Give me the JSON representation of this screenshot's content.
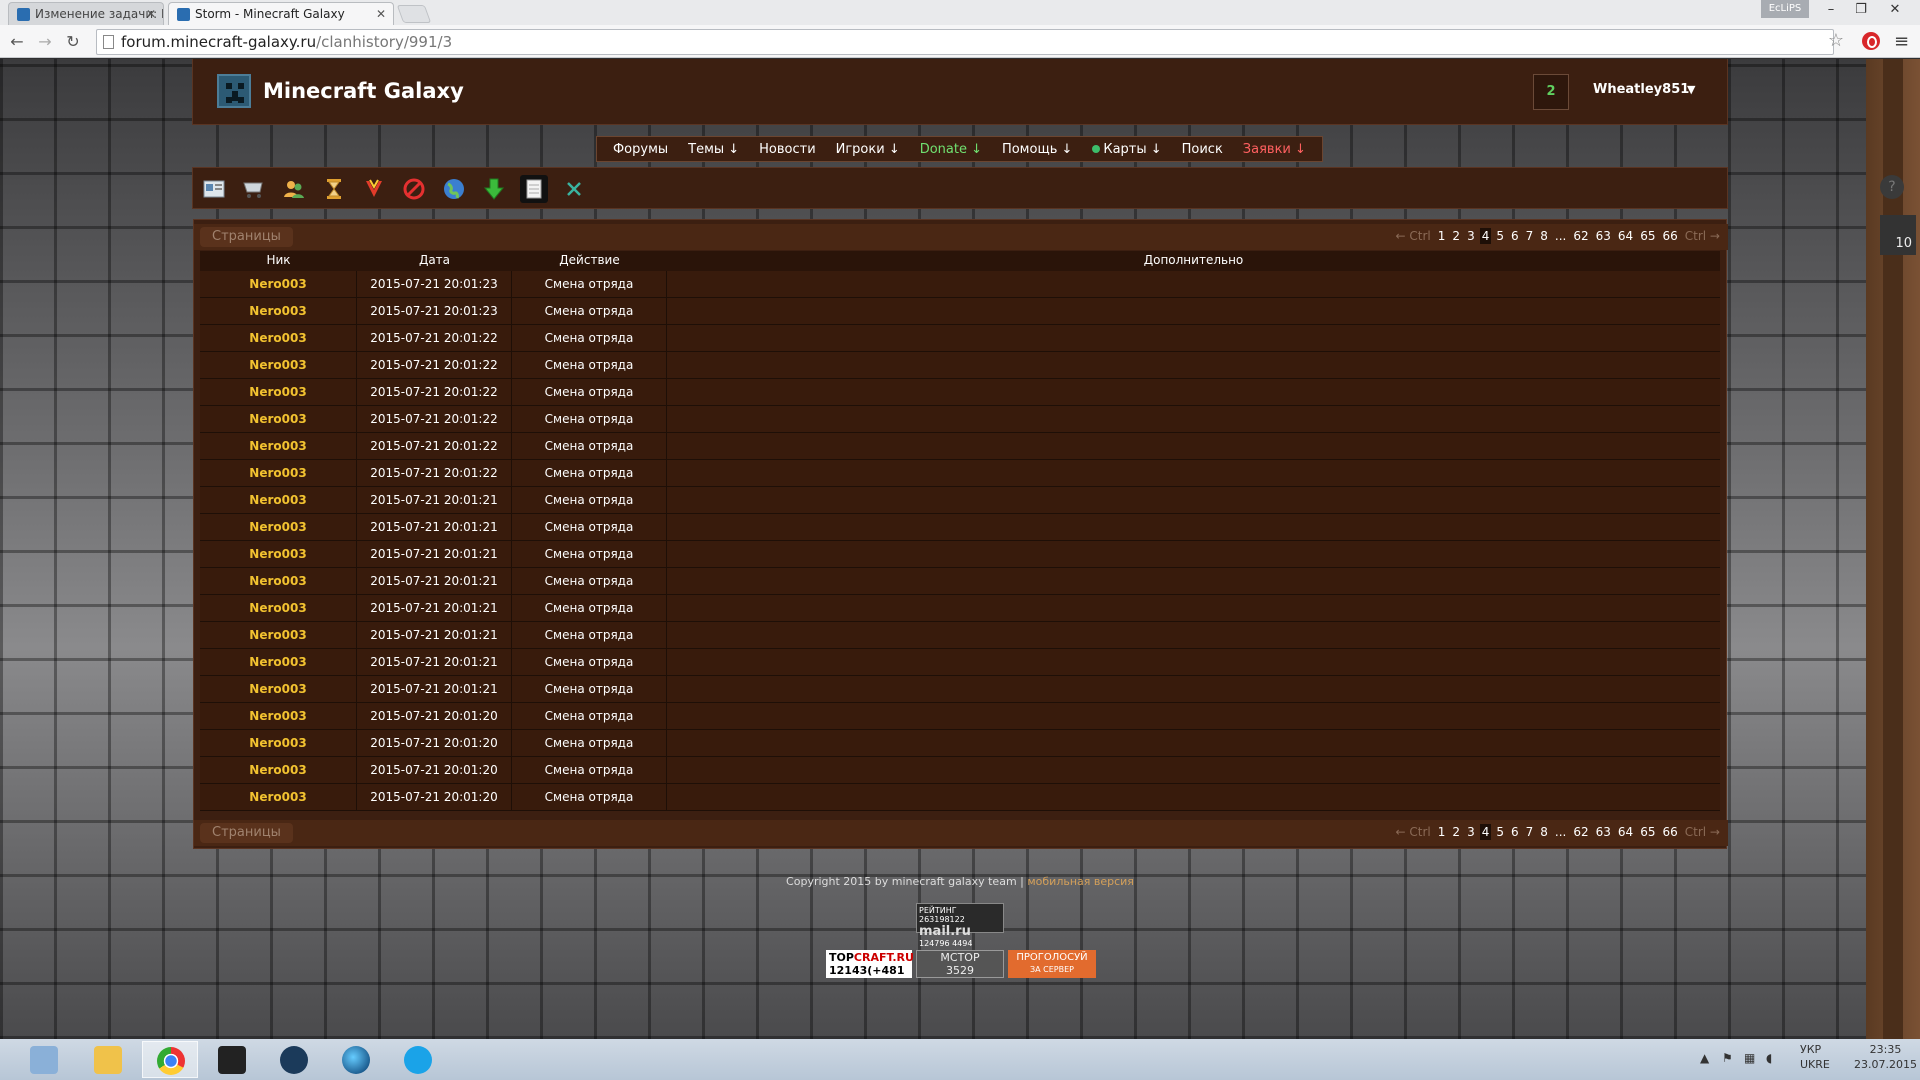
{
  "browser": {
    "tabs": [
      {
        "title": "Изменение задачи: Баг с"
      },
      {
        "title": "Storm - Minecraft Galaxy"
      }
    ],
    "profile": "EcLiPS",
    "url_host": "forum.minecraft-galaxy.ru",
    "url_path": "/clanhistory/991/3"
  },
  "site": {
    "title": "Minecraft Galaxy",
    "notifications": "2",
    "username": "Wheatley851",
    "nav": [
      "Форумы",
      "Темы ↓",
      "Новости",
      "Игроки ↓",
      "Donate ↓",
      "Помощь ↓",
      "Карты ↓",
      "Поиск",
      "Заявки ↓"
    ]
  },
  "pager": {
    "label": "Страницы",
    "prev": "← Ctrl",
    "next": "Ctrl →",
    "pages": [
      "1",
      "2",
      "3",
      "4",
      "5",
      "6",
      "7",
      "8",
      "...",
      "62",
      "63",
      "64",
      "65",
      "66"
    ],
    "current": "3"
  },
  "table": {
    "headers": {
      "nick": "Ник",
      "date": "Дата",
      "action": "Действие",
      "extra": "Дополнительно"
    },
    "rows": [
      {
        "nick": "Nero003",
        "date": "2015-07-21 20:01:23",
        "action": "Смена отряда",
        "extra": ""
      },
      {
        "nick": "Nero003",
        "date": "2015-07-21 20:01:23",
        "action": "Смена отряда",
        "extra": ""
      },
      {
        "nick": "Nero003",
        "date": "2015-07-21 20:01:22",
        "action": "Смена отряда",
        "extra": ""
      },
      {
        "nick": "Nero003",
        "date": "2015-07-21 20:01:22",
        "action": "Смена отряда",
        "extra": ""
      },
      {
        "nick": "Nero003",
        "date": "2015-07-21 20:01:22",
        "action": "Смена отряда",
        "extra": ""
      },
      {
        "nick": "Nero003",
        "date": "2015-07-21 20:01:22",
        "action": "Смена отряда",
        "extra": ""
      },
      {
        "nick": "Nero003",
        "date": "2015-07-21 20:01:22",
        "action": "Смена отряда",
        "extra": ""
      },
      {
        "nick": "Nero003",
        "date": "2015-07-21 20:01:22",
        "action": "Смена отряда",
        "extra": ""
      },
      {
        "nick": "Nero003",
        "date": "2015-07-21 20:01:21",
        "action": "Смена отряда",
        "extra": ""
      },
      {
        "nick": "Nero003",
        "date": "2015-07-21 20:01:21",
        "action": "Смена отряда",
        "extra": ""
      },
      {
        "nick": "Nero003",
        "date": "2015-07-21 20:01:21",
        "action": "Смена отряда",
        "extra": ""
      },
      {
        "nick": "Nero003",
        "date": "2015-07-21 20:01:21",
        "action": "Смена отряда",
        "extra": ""
      },
      {
        "nick": "Nero003",
        "date": "2015-07-21 20:01:21",
        "action": "Смена отряда",
        "extra": ""
      },
      {
        "nick": "Nero003",
        "date": "2015-07-21 20:01:21",
        "action": "Смена отряда",
        "extra": ""
      },
      {
        "nick": "Nero003",
        "date": "2015-07-21 20:01:21",
        "action": "Смена отряда",
        "extra": ""
      },
      {
        "nick": "Nero003",
        "date": "2015-07-21 20:01:21",
        "action": "Смена отряда",
        "extra": ""
      },
      {
        "nick": "Nero003",
        "date": "2015-07-21 20:01:20",
        "action": "Смена отряда",
        "extra": ""
      },
      {
        "nick": "Nero003",
        "date": "2015-07-21 20:01:20",
        "action": "Смена отряда",
        "extra": ""
      },
      {
        "nick": "Nero003",
        "date": "2015-07-21 20:01:20",
        "action": "Смена отряда",
        "extra": ""
      },
      {
        "nick": "Nero003",
        "date": "2015-07-21 20:01:20",
        "action": "Смена отряда",
        "extra": ""
      }
    ]
  },
  "footer": {
    "copyright": "Copyright 2015 by minecraft galaxy team |",
    "mobile": "мобильная версия",
    "counter_label": "РЕЙТИНГ 263198122",
    "counter_mail": "mail.ru",
    "counter_nums": "124796  4494",
    "topcraft_a": "TOP",
    "topcraft_b": "CRAFT.RU",
    "topcraft_num": "12143(+481",
    "mctop_name": "MCTOP",
    "mctop_num": "3529",
    "vote_line1": "ПРОГОЛОСУЙ",
    "vote_line2": "ЗА СЕРВЕР"
  },
  "side": {
    "count": "10"
  },
  "taskbar": {
    "lang_line1": "УКР",
    "lang_line2": "UKRE",
    "time": "23:35",
    "date": "23.07.2015"
  }
}
